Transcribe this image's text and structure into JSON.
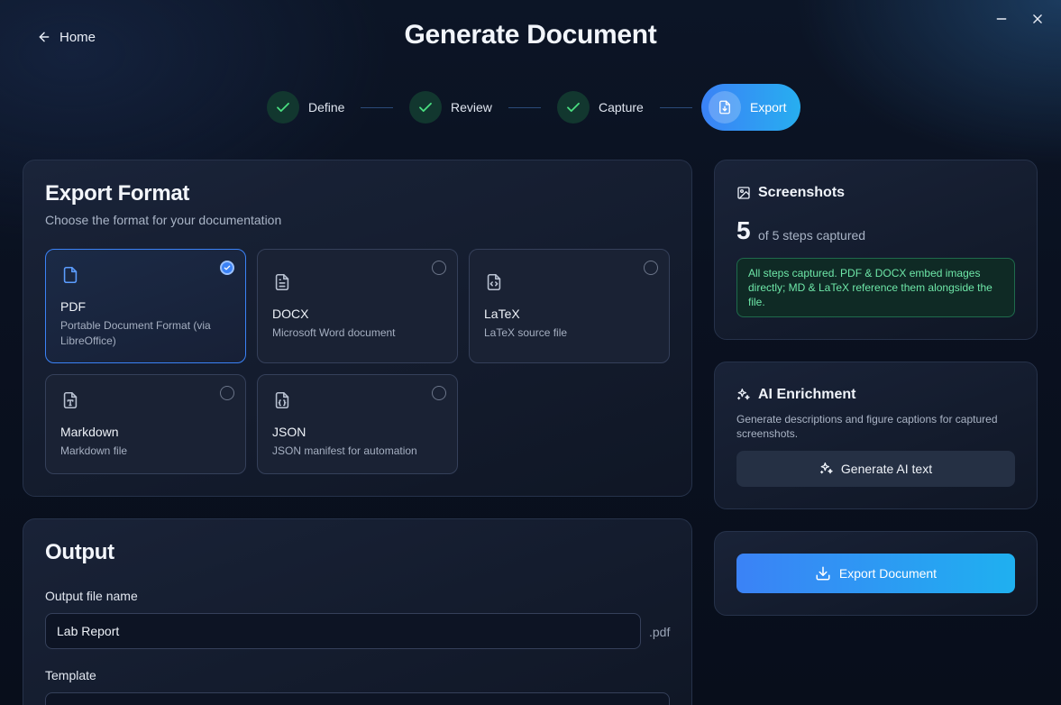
{
  "header": {
    "home_label": "Home",
    "title": "Generate Document"
  },
  "stepper": {
    "steps": [
      {
        "label": "Define",
        "state": "complete"
      },
      {
        "label": "Review",
        "state": "complete"
      },
      {
        "label": "Capture",
        "state": "complete"
      },
      {
        "label": "Export",
        "state": "active"
      }
    ]
  },
  "export_format": {
    "title": "Export Format",
    "subtitle": "Choose the format for your documentation",
    "selected": "PDF",
    "formats": [
      {
        "name": "PDF",
        "description": "Portable Document Format (via LibreOffice)",
        "icon": "file-icon"
      },
      {
        "name": "DOCX",
        "description": "Microsoft Word document",
        "icon": "file-text-icon"
      },
      {
        "name": "LaTeX",
        "description": "LaTeX source file",
        "icon": "file-code-icon"
      },
      {
        "name": "Markdown",
        "description": "Markdown file",
        "icon": "file-type-icon"
      },
      {
        "name": "JSON",
        "description": "JSON manifest for automation",
        "icon": "file-json-icon"
      }
    ]
  },
  "output": {
    "title": "Output",
    "file_name_label": "Output file name",
    "file_name_value": "Lab Report",
    "extension": ".pdf",
    "template_label": "Template"
  },
  "screenshots": {
    "title": "Screenshots",
    "count": "5",
    "caption": "of 5 steps captured",
    "message": "All steps captured. PDF & DOCX embed images directly; MD & LaTeX reference them alongside the file."
  },
  "ai_enrichment": {
    "title": "AI Enrichment",
    "description": "Generate descriptions and figure captions for captured screenshots.",
    "button_label": "Generate AI text"
  },
  "export": {
    "button_label": "Export Document"
  },
  "colors": {
    "accent": "#3b82f6",
    "accent_2": "#27aef0",
    "success": "#6ee7a8",
    "complete_step": "#12372f"
  }
}
